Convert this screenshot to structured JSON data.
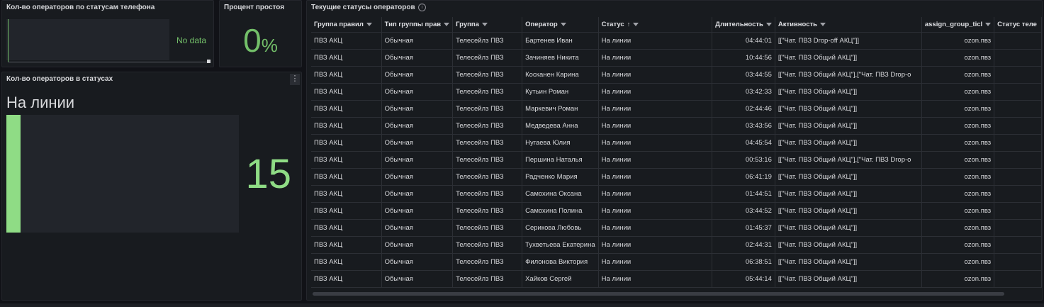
{
  "panels": {
    "phone_status": {
      "title": "Кол-во операторов по статусам телефона",
      "message": "No data"
    },
    "idle_percent": {
      "title": "Процент простоя",
      "value": "0",
      "unit": "%"
    },
    "operators_status": {
      "title": "Кол-во операторов в статусах",
      "label": "На линии",
      "value": "15",
      "menu_icon": "vertical-dots-icon",
      "fill_fraction": 1.0
    },
    "current_statuses": {
      "title": "Текущие статусы операторов",
      "info_icon": "info-icon"
    }
  },
  "colors": {
    "accent_green": "#73bf69",
    "bar_green": "#8fdc85",
    "background": "#111217",
    "panel": "#181b1f"
  },
  "table": {
    "columns": [
      {
        "label": "Группа правил",
        "filter": true,
        "sort": false
      },
      {
        "label": "Тип группы прав",
        "filter": true,
        "sort": false
      },
      {
        "label": "Группа",
        "filter": true,
        "sort": false
      },
      {
        "label": "Оператор",
        "filter": true,
        "sort": false
      },
      {
        "label": "Статус",
        "filter": true,
        "sort": true
      },
      {
        "label": "Длительность",
        "filter": true,
        "sort": false
      },
      {
        "label": "Активность",
        "filter": true,
        "sort": false
      },
      {
        "label": "assign_group_ticl",
        "filter": true,
        "sort": false
      },
      {
        "label": "Статус теле",
        "filter": false,
        "sort": false
      }
    ],
    "sort_indicator": "↑",
    "rows": [
      [
        "ПВЗ АКЦ",
        "Обычная",
        "Телесейлз ПВЗ",
        "Бартенев Иван",
        "На линии",
        "04:44:01",
        "[[\"Чат. ПВЗ Drop-off АКЦ\"]]",
        "ozon.пвз",
        ""
      ],
      [
        "ПВЗ АКЦ",
        "Обычная",
        "Телесейлз ПВЗ",
        "Зачиняев Никита",
        "На линии",
        "10:44:56",
        "[[\"Чат. ПВЗ Общий АКЦ\"]]",
        "ozon.пвз",
        ""
      ],
      [
        "ПВЗ АКЦ",
        "Обычная",
        "Телесейлз ПВЗ",
        "Косканен Карина",
        "На линии",
        "03:44:55",
        "[[\"Чат. ПВЗ Общий АКЦ\"],[\"Чат. ПВЗ Drop-o",
        "ozon.пвз",
        ""
      ],
      [
        "ПВЗ АКЦ",
        "Обычная",
        "Телесейлз ПВЗ",
        "Кутьин Роман",
        "На линии",
        "03:42:33",
        "[[\"Чат. ПВЗ Общий АКЦ\"]]",
        "ozon.пвз",
        ""
      ],
      [
        "ПВЗ АКЦ",
        "Обычная",
        "Телесейлз ПВЗ",
        "Маркевич Роман",
        "На линии",
        "02:44:46",
        "[[\"Чат. ПВЗ Общий АКЦ\"]]",
        "ozon.пвз",
        ""
      ],
      [
        "ПВЗ АКЦ",
        "Обычная",
        "Телесейлз ПВЗ",
        "Медведева Анна",
        "На линии",
        "03:43:56",
        "[[\"Чат. ПВЗ Общий АКЦ\"]]",
        "ozon.пвз",
        ""
      ],
      [
        "ПВЗ АКЦ",
        "Обычная",
        "Телесейлз ПВЗ",
        "Нугаева Юлия",
        "На линии",
        "04:45:54",
        "[[\"Чат. ПВЗ Общий АКЦ\"]]",
        "ozon.пвз",
        ""
      ],
      [
        "ПВЗ АКЦ",
        "Обычная",
        "Телесейлз ПВЗ",
        "Першина Наталья",
        "На линии",
        "00:53:16",
        "[[\"Чат. ПВЗ Общий АКЦ\"],[\"Чат. ПВЗ Drop-o",
        "ozon.пвз",
        ""
      ],
      [
        "ПВЗ АКЦ",
        "Обычная",
        "Телесейлз ПВЗ",
        "Радченко Мария",
        "На линии",
        "06:41:19",
        "[[\"Чат. ПВЗ Общий АКЦ\"]]",
        "ozon.пвз",
        ""
      ],
      [
        "ПВЗ АКЦ",
        "Обычная",
        "Телесейлз ПВЗ",
        "Самохина Оксана",
        "На линии",
        "01:44:51",
        "[[\"Чат. ПВЗ Общий АКЦ\"]]",
        "ozon.пвз",
        ""
      ],
      [
        "ПВЗ АКЦ",
        "Обычная",
        "Телесейлз ПВЗ",
        "Самохина Полина",
        "На линии",
        "03:44:52",
        "[[\"Чат. ПВЗ Общий АКЦ\"]]",
        "ozon.пвз",
        ""
      ],
      [
        "ПВЗ АКЦ",
        "Обычная",
        "Телесейлз ПВЗ",
        "Серикова Любовь",
        "На линии",
        "01:45:37",
        "[[\"Чат. ПВЗ Общий АКЦ\"]]",
        "ozon.пвз",
        ""
      ],
      [
        "ПВЗ АКЦ",
        "Обычная",
        "Телесейлз ПВЗ",
        "Тухветьева Екатерина",
        "На линии",
        "02:44:31",
        "[[\"Чат. ПВЗ Общий АКЦ\"]]",
        "ozon.пвз",
        ""
      ],
      [
        "ПВЗ АКЦ",
        "Обычная",
        "Телесейлз ПВЗ",
        "Филонова Виктория",
        "На линии",
        "06:38:51",
        "[[\"Чат. ПВЗ Общий АКЦ\"]]",
        "ozon.пвз",
        ""
      ],
      [
        "ПВЗ АКЦ",
        "Обычная",
        "Телесейлз ПВЗ",
        "Хайков Сергей",
        "На линии",
        "05:44:14",
        "[[\"Чат. ПВЗ Общий АКЦ\"]]",
        "ozon.пвз",
        ""
      ]
    ]
  }
}
